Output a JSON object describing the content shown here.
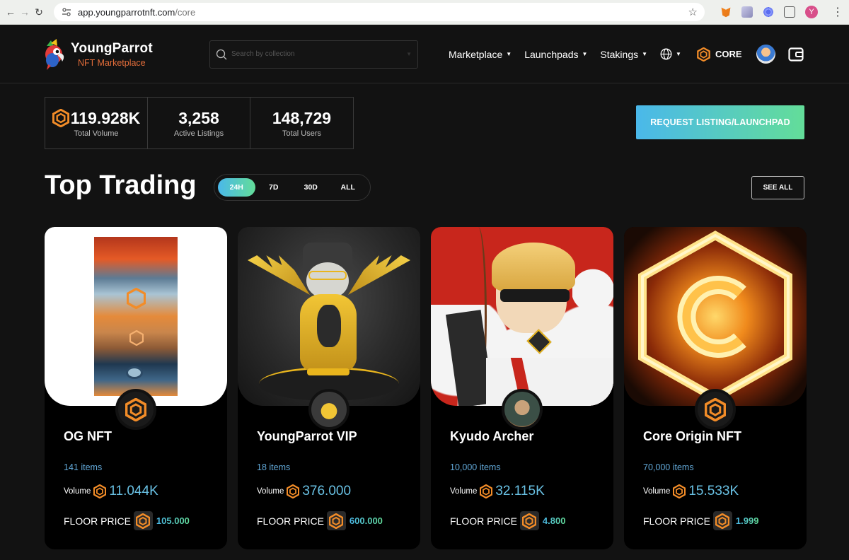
{
  "browser": {
    "url_host": "app.youngparrotnft.com",
    "url_path": "/core",
    "profile_initial": "Y"
  },
  "header": {
    "logo_title": "YoungParrot",
    "logo_subtitle": "NFT Marketplace",
    "search_placeholder": "Search by collection",
    "menu": [
      {
        "label": "Marketplace"
      },
      {
        "label": "Launchpads"
      },
      {
        "label": "Stakings"
      }
    ],
    "chain_label": "CORE"
  },
  "stats": [
    {
      "value": "119.928K",
      "label": "Total Volume"
    },
    {
      "value": "3,258",
      "label": "Active Listings"
    },
    {
      "value": "148,729",
      "label": "Total Users"
    }
  ],
  "request_button": "REQUEST LISTING/LAUNCHPAD",
  "top_trading": {
    "title": "Top Trading",
    "tabs": [
      "24H",
      "7D",
      "30D",
      "ALL"
    ],
    "active_tab": "24H",
    "see_all": "SEE ALL"
  },
  "collections": [
    {
      "name": "OG NFT",
      "items": "141 items",
      "volume_label": "Volume",
      "volume": "11.044K",
      "floor_label": "FLOOR PRICE",
      "floor": "105.000"
    },
    {
      "name": "YoungParrot VIP",
      "items": "18 items",
      "volume_label": "Volume",
      "volume": "376.000",
      "floor_label": "FLOOR PRICE",
      "floor": "600.000"
    },
    {
      "name": "Kyudo Archer",
      "items": "10,000 items",
      "volume_label": "Volume",
      "volume": "32.115K",
      "floor_label": "FLOOR PRICE",
      "floor": "4.800"
    },
    {
      "name": "Core Origin NFT",
      "items": "70,000 items",
      "volume_label": "Volume",
      "volume": "15.533K",
      "floor_label": "FLOOR PRICE",
      "floor": "1.999"
    }
  ],
  "colors": {
    "accent_gradient_start": "#4ab8ea",
    "accent_gradient_end": "#63dd99",
    "core_orange": "#f28c28",
    "items_blue": "#62a9d9"
  }
}
